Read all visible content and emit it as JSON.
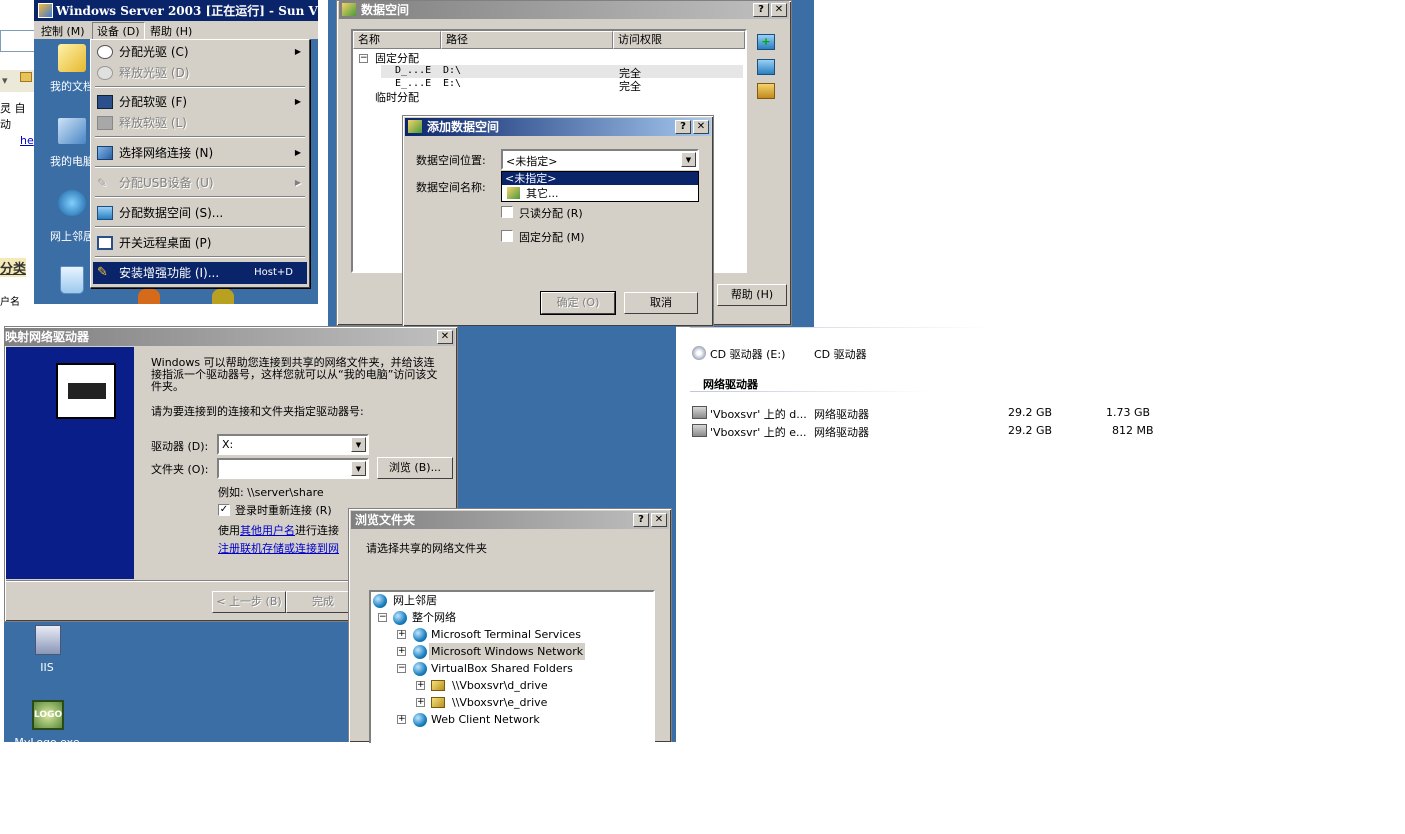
{
  "vm_window": {
    "title": "Windows Server 2003 [正在运行] - Sun V",
    "menubar": [
      "控制 (M)",
      "设备 (D)",
      "帮助 (H)"
    ],
    "desktop_labels": [
      "我的文档",
      "我的电脑",
      "网上邻居"
    ],
    "devices_menu": {
      "items": [
        {
          "label": "分配光驱 (C)",
          "disabled": false,
          "submenu": true
        },
        {
          "label": "释放光驱 (D)",
          "disabled": true,
          "submenu": false
        },
        {
          "label": "分配软驱 (F)",
          "disabled": false,
          "submenu": true
        },
        {
          "label": "释放软驱 (L)",
          "disabled": true,
          "submenu": false
        },
        {
          "label": "选择网络连接 (N)",
          "disabled": false,
          "submenu": true
        },
        {
          "label": "分配USB设备 (U)",
          "disabled": true,
          "submenu": true
        },
        {
          "label": "分配数据空间 (S)...",
          "disabled": false,
          "submenu": false
        },
        {
          "label": "开关远程桌面 (P)",
          "disabled": false,
          "submenu": false
        },
        {
          "label": "安装增强功能 (I)...",
          "disabled": false,
          "submenu": false,
          "shortcut": "Host+D"
        }
      ]
    }
  },
  "left_fragment": {
    "text1": "灵 自动",
    "link": "he",
    "heading": "分类",
    "text2": "户名"
  },
  "shared_folders_dialog": {
    "title": "数据空间",
    "columns": [
      "名称",
      "路径",
      "访问权限"
    ],
    "groups": {
      "fixed": "固定分配",
      "temp": "临时分配"
    },
    "rows": [
      {
        "name": "D_...E",
        "path": "D:\\",
        "access": "完全"
      },
      {
        "name": "E_...E",
        "path": "E:\\",
        "access": "完全"
      }
    ],
    "help_button": "帮助 (H)"
  },
  "add_share_dialog": {
    "title": "添加数据空间",
    "location_label": "数据空间位置:",
    "location_value": "<未指定>",
    "name_label": "数据空间名称:",
    "dropdown_options": [
      "<未指定>",
      "其它..."
    ],
    "readonly_label": "只读分配 (R)",
    "permanent_label": "固定分配 (M)",
    "ok_button": "确定 (O)",
    "cancel_button": "取消"
  },
  "map_drive_dialog": {
    "title": "映射网络驱动器",
    "intro": "Windows 可以帮助您连接到共享的网络文件夹，并给该连接指派一个驱动器号，这样您就可以从“我的电脑”访问该文件夹。",
    "prompt": "请为要连接到的连接和文件夹指定驱动器号:",
    "drive_label": "驱动器 (D):",
    "drive_value": "X:",
    "folder_label": "文件夹 (O):",
    "folder_value": "",
    "browse_button": "浏览 (B)...",
    "example": "例如: \\\\server\\share",
    "reconnect_label": "登录时重新连接 (R)",
    "use_other_prefix": "使用",
    "use_other_link": "其他用户名",
    "use_other_suffix": "进行连接",
    "register_link": "注册联机存储或连接到网",
    "back_button": "< 上一步 (B)",
    "finish_button": "完成"
  },
  "desktop_icons": [
    "IIS",
    "MyLogo.exe"
  ],
  "browse_dialog": {
    "title": "浏览文件夹",
    "prompt": "请选择共享的网络文件夹",
    "tree": [
      {
        "label": "网上邻居",
        "level": 0,
        "expander": ""
      },
      {
        "label": "整个网络",
        "level": 1,
        "expander": "−"
      },
      {
        "label": "Microsoft Terminal Services",
        "level": 2,
        "expander": "+"
      },
      {
        "label": "Microsoft Windows Network",
        "level": 2,
        "expander": "+",
        "selected": true
      },
      {
        "label": "VirtualBox Shared Folders",
        "level": 2,
        "expander": "−"
      },
      {
        "label": "\\\\Vboxsvr\\d_drive",
        "level": 3,
        "expander": "+"
      },
      {
        "label": "\\\\Vboxsvr\\e_drive",
        "level": 3,
        "expander": "+"
      },
      {
        "label": "Web Client Network",
        "level": 2,
        "expander": "+"
      }
    ]
  },
  "explorer_list": {
    "cd_name": "CD 驱动器 (E:)",
    "cd_type": "CD 驱动器",
    "network_header": "网络驱动器",
    "drives": [
      {
        "name": "'Vboxsvr' 上的 d...",
        "type": "网络驱动器",
        "total": "29.2 GB",
        "free": "1.73 GB"
      },
      {
        "name": "'Vboxsvr' 上的 e...",
        "type": "网络驱动器",
        "total": "29.2 GB",
        "free": "812 MB"
      }
    ]
  },
  "colors": {
    "desktop_blue": "#3a6ea5",
    "title_active": "#0a246a",
    "face": "#d4d0c8"
  }
}
